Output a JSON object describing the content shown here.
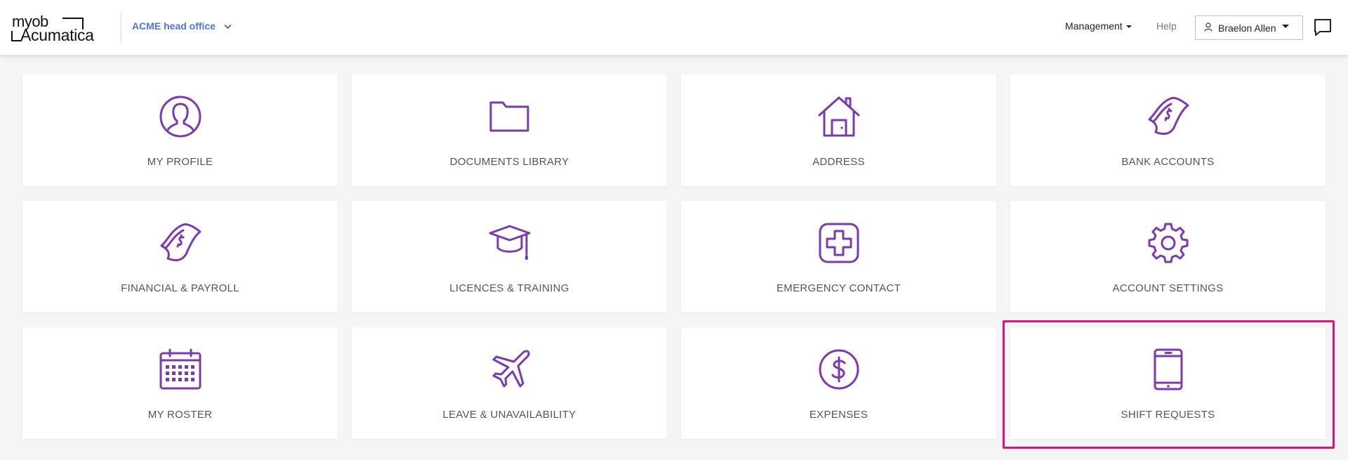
{
  "header": {
    "logo_line1": "myob",
    "logo_line2": "Acumatica",
    "org_name": "ACME head office",
    "management_label": "Management",
    "help_label": "Help",
    "user_name": "Braelon Allen"
  },
  "tiles": [
    {
      "label": "MY PROFILE",
      "icon": "profile-icon"
    },
    {
      "label": "DOCUMENTS LIBRARY",
      "icon": "folder-icon"
    },
    {
      "label": "ADDRESS",
      "icon": "house-icon"
    },
    {
      "label": "BANK ACCOUNTS",
      "icon": "banknote-icon"
    },
    {
      "label": "FINANCIAL & PAYROLL",
      "icon": "banknote-icon"
    },
    {
      "label": "LICENCES & TRAINING",
      "icon": "graduation-cap-icon"
    },
    {
      "label": "EMERGENCY CONTACT",
      "icon": "medical-cross-icon"
    },
    {
      "label": "ACCOUNT SETTINGS",
      "icon": "gear-icon"
    },
    {
      "label": "MY ROSTER",
      "icon": "calendar-icon"
    },
    {
      "label": "LEAVE & UNAVAILABILITY",
      "icon": "airplane-icon"
    },
    {
      "label": "EXPENSES",
      "icon": "dollar-coin-icon"
    },
    {
      "label": "SHIFT REQUESTS",
      "icon": "tablet-icon"
    }
  ],
  "colors": {
    "accent": "#7c3aad",
    "org_link": "#4a78d8",
    "highlight": "#e2127a"
  }
}
